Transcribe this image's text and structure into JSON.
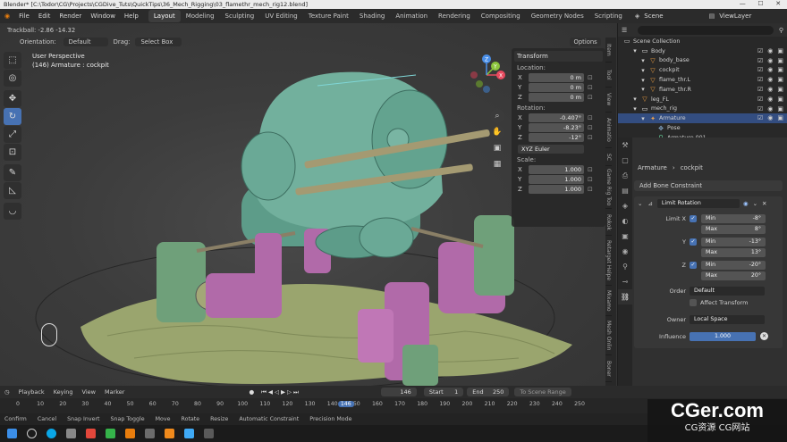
{
  "window": {
    "title": "Blender* [C:\\Todor\\CG\\Projects\\CGDive_Tuts\\QuickTips\\36_Mech_Rigging\\03_flamethr_mech_rig12.blend]"
  },
  "menus": [
    "File",
    "Edit",
    "Render",
    "Window",
    "Help"
  ],
  "workspaces": [
    "Layout",
    "Modeling",
    "Sculpting",
    "UV Editing",
    "Texture Paint",
    "Shading",
    "Animation",
    "Rendering",
    "Compositing",
    "Geometry Nodes",
    "Scripting"
  ],
  "active_workspace": "Layout",
  "scene": {
    "label": "Scene",
    "view_layer": "ViewLayer"
  },
  "viewport": {
    "status": "Trackball: -2.86 -14.32",
    "orientation_label": "Orientation:",
    "orientation_value": "Default",
    "drag_label": "Drag:",
    "drag_value": "Select Box",
    "options": "Options",
    "view_name": "User Perspective",
    "view_object": "(146) Armature : cockpit",
    "gizmo": {
      "x": "X",
      "y": "Y",
      "z": "Z"
    }
  },
  "transform": {
    "title": "Transform",
    "location_label": "Location:",
    "location": [
      {
        "axis": "X",
        "value": "0 m"
      },
      {
        "axis": "Y",
        "value": "0 m"
      },
      {
        "axis": "Z",
        "value": "0 m"
      }
    ],
    "rotation_label": "Rotation:",
    "rotation": [
      {
        "axis": "X",
        "value": "-0.407°"
      },
      {
        "axis": "Y",
        "value": "-8.23°"
      },
      {
        "axis": "Z",
        "value": "-12°"
      }
    ],
    "rotation_mode": "XYZ Euler",
    "scale_label": "Scale:",
    "scale": [
      {
        "axis": "X",
        "value": "1.000"
      },
      {
        "axis": "Y",
        "value": "1.000"
      },
      {
        "axis": "Z",
        "value": "1.000"
      }
    ]
  },
  "side_tabs": [
    "Item",
    "Tool",
    "View",
    "Animatio",
    "SC",
    "Game Rig Too",
    "Rokok",
    "Retarget Helpe",
    "Mixamo",
    "Mesh Onlin",
    "Boner"
  ],
  "outliner": {
    "root": "Scene Collection",
    "rows": [
      {
        "name": "Body",
        "icon": "collection-icon",
        "indent": 1
      },
      {
        "name": "body_base",
        "icon": "mesh-icon",
        "indent": 2
      },
      {
        "name": "cockpit",
        "icon": "mesh-icon",
        "indent": 2
      },
      {
        "name": "flame_thr.L",
        "icon": "mesh-icon",
        "indent": 2
      },
      {
        "name": "flame_thr.R",
        "icon": "mesh-icon",
        "indent": 2
      },
      {
        "name": "leg_FL",
        "icon": "mesh-icon",
        "indent": 1
      },
      {
        "name": "mech_rig",
        "icon": "collection-icon",
        "indent": 1
      },
      {
        "name": "Armature",
        "icon": "armature-icon",
        "indent": 2,
        "selected": true
      },
      {
        "name": "Pose",
        "icon": "pose-icon",
        "indent": 3
      },
      {
        "name": "Armature.001",
        "icon": "armature-data-icon",
        "indent": 3
      }
    ]
  },
  "properties": {
    "breadcrumb": [
      "Armature",
      "cockpit"
    ],
    "add_constraint": "Add Bone Constraint",
    "constraint_name": "Limit Rotation",
    "limits": [
      {
        "axis": "Limit X",
        "min_label": "Min",
        "min": "-8°",
        "max_label": "Max",
        "max": "8°"
      },
      {
        "axis": "Y",
        "min_label": "Min",
        "min": "-13°",
        "max_label": "Max",
        "max": "13°"
      },
      {
        "axis": "Z",
        "min_label": "Min",
        "min": "-20°",
        "max_label": "Max",
        "max": "20°"
      }
    ],
    "order_label": "Order",
    "order_value": "Default",
    "affect_transform": "Affect Transform",
    "owner_label": "Owner",
    "owner_value": "Local Space",
    "influence_label": "Influence",
    "influence_value": "1.000",
    "influence_fraction": 1.0
  },
  "timeline": {
    "menus": [
      "Playback",
      "Keying",
      "View",
      "Marker"
    ],
    "current_frame": "146",
    "start_label": "Start",
    "start": "1",
    "end_label": "End",
    "end": "250",
    "scene_range": "To Scene Range",
    "ticks": [
      "0",
      "10",
      "20",
      "30",
      "40",
      "50",
      "60",
      "70",
      "80",
      "90",
      "100",
      "110",
      "120",
      "130",
      "140",
      "146",
      "150",
      "160",
      "170",
      "180",
      "190",
      "200",
      "210",
      "220",
      "230",
      "240",
      "250"
    ]
  },
  "statusbar": [
    "Confirm",
    "Cancel",
    "Snap Invert",
    "Snap Toggle",
    "Move",
    "Rotate",
    "Resize",
    "Automatic Constraint",
    "Precision Mode"
  ],
  "watermark": {
    "title": "CGer.com",
    "subtitle": "CG资源 CG网站"
  },
  "colors": {
    "accent": "#4772b3",
    "header": "#2b2b2b",
    "panel": "#303030",
    "mesh_green": "#6fa895",
    "mesh_pink": "#b16aa9",
    "ground": "#9aa56e"
  }
}
